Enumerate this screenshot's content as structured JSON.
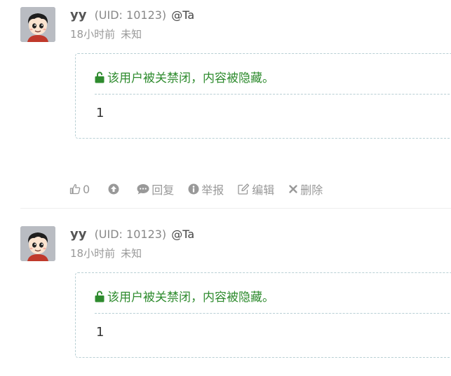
{
  "posts": [
    {
      "username": "yy",
      "uid": "(UID: 10123)",
      "at": "@Ta",
      "time": "18小时前",
      "location": "未知",
      "notice": "该用户被关禁闭，内容被隐藏。",
      "content": "1",
      "actions": {
        "like_count": "0",
        "reply": "回复",
        "report": "举报",
        "edit": "编辑",
        "delete": "删除"
      }
    },
    {
      "username": "yy",
      "uid": "(UID: 10123)",
      "at": "@Ta",
      "time": "18小时前",
      "location": "未知",
      "notice": "该用户被关禁闭，内容被隐藏。",
      "content": "1"
    }
  ],
  "colors": {
    "notice_green": "#2e8b2e",
    "muted_gray": "#999999",
    "dashed_border": "#b8cfd4"
  },
  "icons": [
    "avatar-cartoon-boy",
    "unlock-icon",
    "thumbs-up-icon",
    "arrow-up-circle-icon",
    "comment-icon",
    "info-circle-icon",
    "edit-icon",
    "close-icon"
  ]
}
